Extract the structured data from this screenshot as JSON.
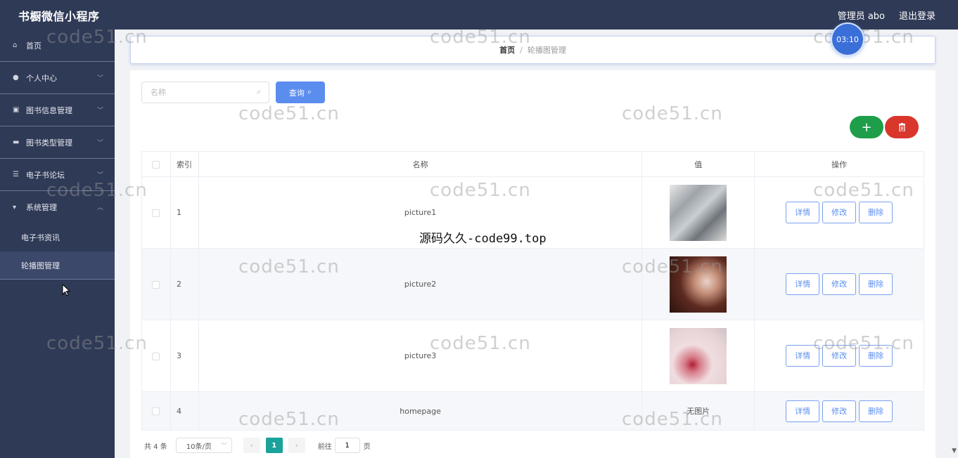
{
  "header": {
    "app_title": "书橱微信小程序",
    "admin_label": "管理员 abo",
    "logout_label": "退出登录"
  },
  "sidebar": {
    "items": [
      {
        "label": "首页",
        "icon": "home-icon"
      },
      {
        "label": "个人中心",
        "icon": "user-icon"
      },
      {
        "label": "图书信息管理",
        "icon": "book-icon"
      },
      {
        "label": "图书类型管理",
        "icon": "category-icon"
      },
      {
        "label": "电子书论坛",
        "icon": "forum-icon"
      },
      {
        "label": "系统管理",
        "icon": "system-icon"
      }
    ],
    "submenu": [
      {
        "label": "电子书资讯"
      },
      {
        "label": "轮播图管理"
      }
    ]
  },
  "breadcrumb": {
    "home": "首页",
    "separator": "/",
    "current": "轮播图管理"
  },
  "search": {
    "placeholder": "名称",
    "query_label": "查询"
  },
  "actions": {
    "add_label": "+",
    "delete_icon": "trash-icon"
  },
  "table": {
    "headers": {
      "index": "索引",
      "name": "名称",
      "value": "值",
      "ops": "操作"
    },
    "rows": [
      {
        "index": "1",
        "name": "picture1",
        "value": "",
        "image": "thumb1"
      },
      {
        "index": "2",
        "name": "picture2",
        "value": "",
        "image": "thumb2"
      },
      {
        "index": "3",
        "name": "picture3",
        "value": "",
        "image": "thumb3"
      },
      {
        "index": "4",
        "name": "homepage",
        "value": "无图片",
        "image": ""
      }
    ],
    "op_labels": {
      "detail": "详情",
      "edit": "修改",
      "delete": "删除"
    }
  },
  "pagination": {
    "total": "共 4 条",
    "page_size": "10条/页",
    "current_page": "1",
    "goto_label": "前往",
    "goto_value": "1",
    "page_unit": "页"
  },
  "overlay": {
    "watermark": "code51.cn",
    "center_text": "源码久久-code99.top",
    "timer": "03:10"
  },
  "colors": {
    "sidebar_bg": "#2f3a56",
    "primary": "#5b8def",
    "add_green": "#1e9e4a",
    "delete_red": "#d9362c",
    "page_active": "#1aa39a"
  }
}
